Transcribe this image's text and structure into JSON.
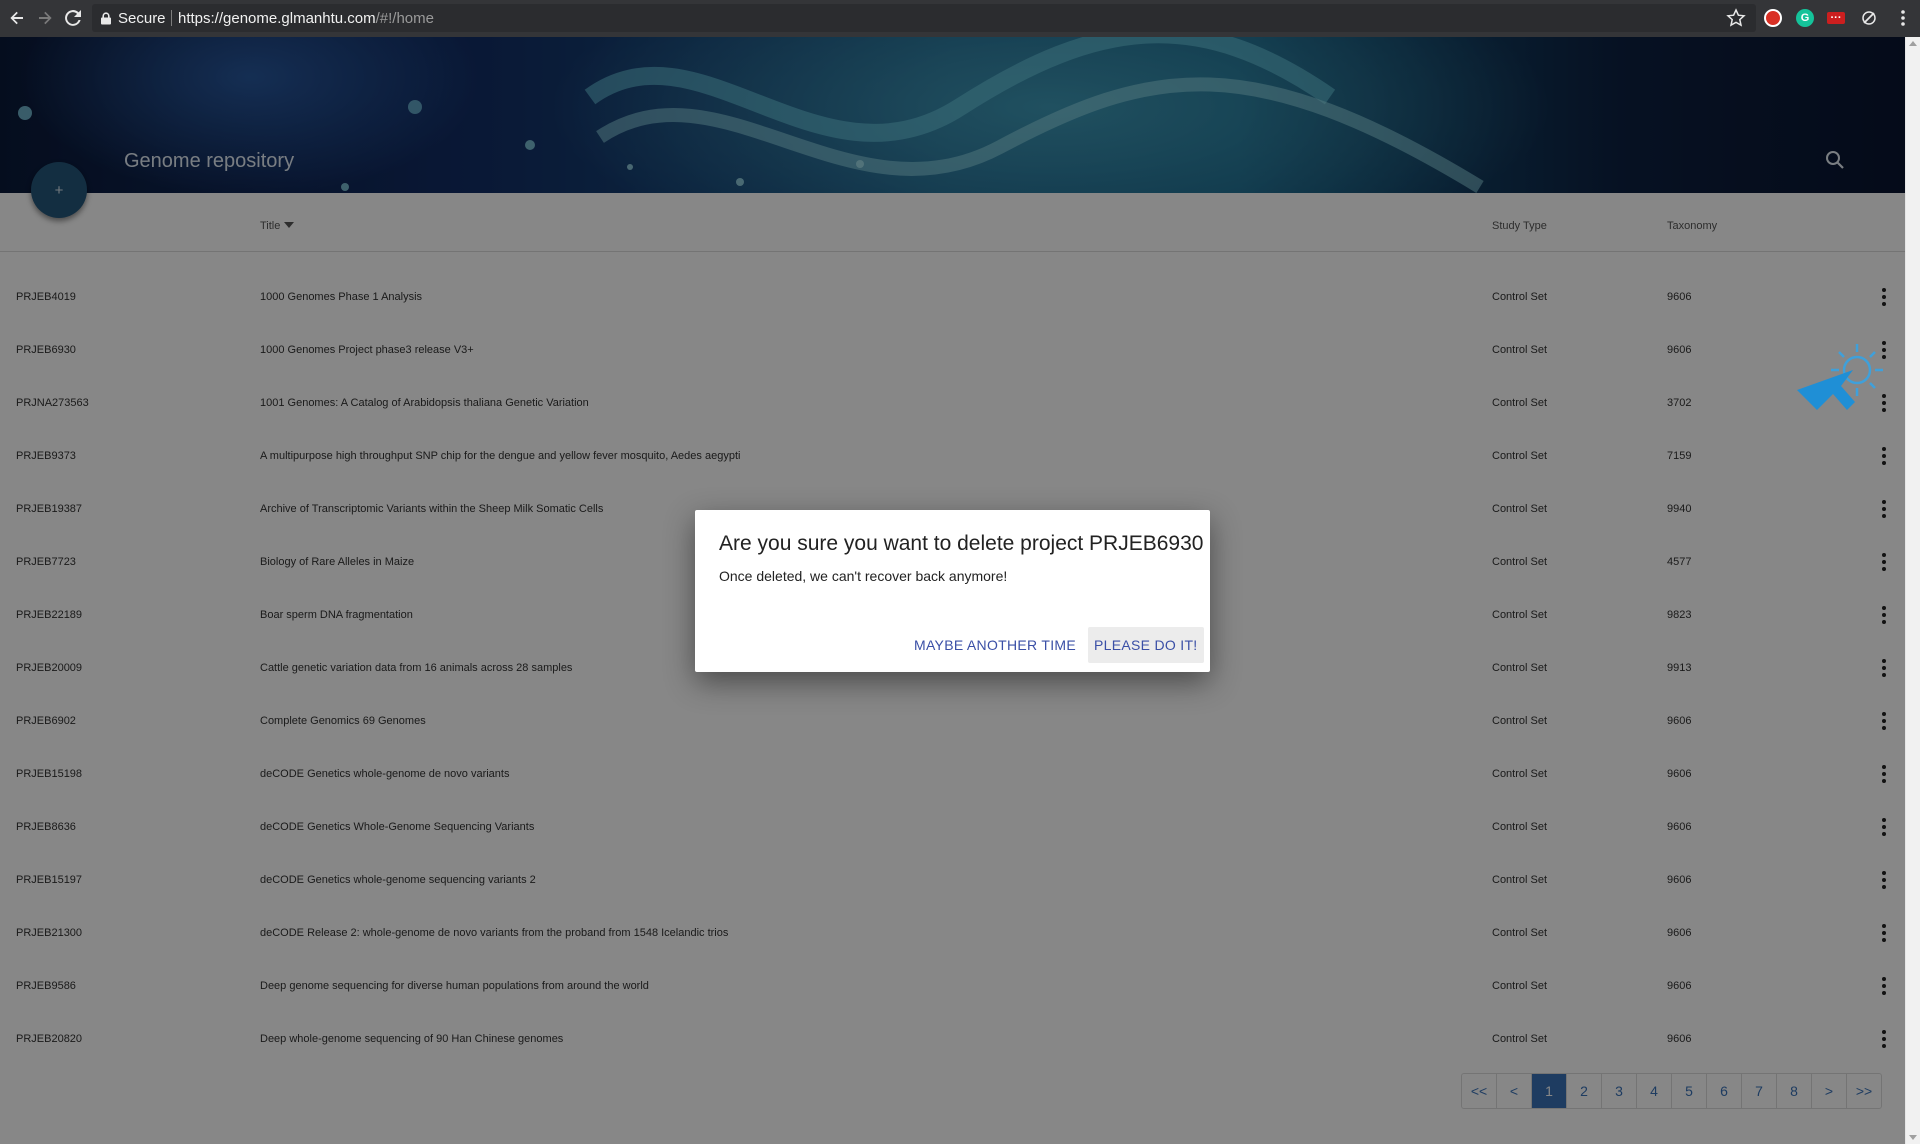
{
  "browser": {
    "secure_label": "Secure",
    "url_host": "https://genome.glmanhtu.com",
    "url_path": "/#!/home"
  },
  "header": {
    "title": "Genome repository",
    "fab_label": "+"
  },
  "table": {
    "columns": {
      "id": "",
      "title": "Title",
      "study_type": "Study Type",
      "taxonomy": "Taxonomy"
    },
    "rows": [
      {
        "id": "PRJEB4019",
        "title": "1000 Genomes Phase 1 Analysis",
        "study_type": "Control Set",
        "taxonomy": "9606"
      },
      {
        "id": "PRJEB6930",
        "title": "1000 Genomes Project phase3 release V3+",
        "study_type": "Control Set",
        "taxonomy": "9606"
      },
      {
        "id": "PRJNA273563",
        "title": "1001 Genomes: A Catalog of Arabidopsis thaliana Genetic Variation",
        "study_type": "Control Set",
        "taxonomy": "3702"
      },
      {
        "id": "PRJEB9373",
        "title": "A multipurpose high throughput SNP chip for the dengue and yellow fever mosquito, Aedes aegypti",
        "study_type": "Control Set",
        "taxonomy": "7159"
      },
      {
        "id": "PRJEB19387",
        "title": "Archive of Transcriptomic Variants within the Sheep Milk Somatic Cells",
        "study_type": "Control Set",
        "taxonomy": "9940"
      },
      {
        "id": "PRJEB7723",
        "title": "Biology of Rare Alleles in Maize",
        "study_type": "Control Set",
        "taxonomy": "4577"
      },
      {
        "id": "PRJEB22189",
        "title": "Boar sperm DNA fragmentation",
        "study_type": "Control Set",
        "taxonomy": "9823"
      },
      {
        "id": "PRJEB20009",
        "title": "Cattle genetic variation data from 16 animals across 28 samples",
        "study_type": "Control Set",
        "taxonomy": "9913"
      },
      {
        "id": "PRJEB6902",
        "title": "Complete Genomics 69 Genomes",
        "study_type": "Control Set",
        "taxonomy": "9606"
      },
      {
        "id": "PRJEB15198",
        "title": "deCODE Genetics whole-genome de novo variants",
        "study_type": "Control Set",
        "taxonomy": "9606"
      },
      {
        "id": "PRJEB8636",
        "title": "deCODE Genetics Whole-Genome Sequencing Variants",
        "study_type": "Control Set",
        "taxonomy": "9606"
      },
      {
        "id": "PRJEB15197",
        "title": "deCODE Genetics whole-genome sequencing variants 2",
        "study_type": "Control Set",
        "taxonomy": "9606"
      },
      {
        "id": "PRJEB21300",
        "title": "deCODE Release 2: whole-genome de novo variants from the proband from 1548 Icelandic trios",
        "study_type": "Control Set",
        "taxonomy": "9606"
      },
      {
        "id": "PRJEB9586",
        "title": "Deep genome sequencing for diverse human populations from around the world",
        "study_type": "Control Set",
        "taxonomy": "9606"
      },
      {
        "id": "PRJEB20820",
        "title": "Deep whole-genome sequencing of 90 Han Chinese genomes",
        "study_type": "Control Set",
        "taxonomy": "9606"
      }
    ]
  },
  "pagination": [
    "<<",
    "<",
    "1",
    "2",
    "3",
    "4",
    "5",
    "6",
    "7",
    "8",
    ">",
    ">>"
  ],
  "pagination_active": "1",
  "dialog": {
    "title": "Are you sure you want to delete project PRJEB6930",
    "body": "Once deleted, we can't recover back anymore!",
    "cancel_label": "MAYBE ANOTHER TIME",
    "confirm_label": "PLEASE DO IT!"
  },
  "colors": {
    "accent": "#3a72b8",
    "dialog_button": "#3a4fa6",
    "fab": "#25577c",
    "chrome": "#343538"
  }
}
